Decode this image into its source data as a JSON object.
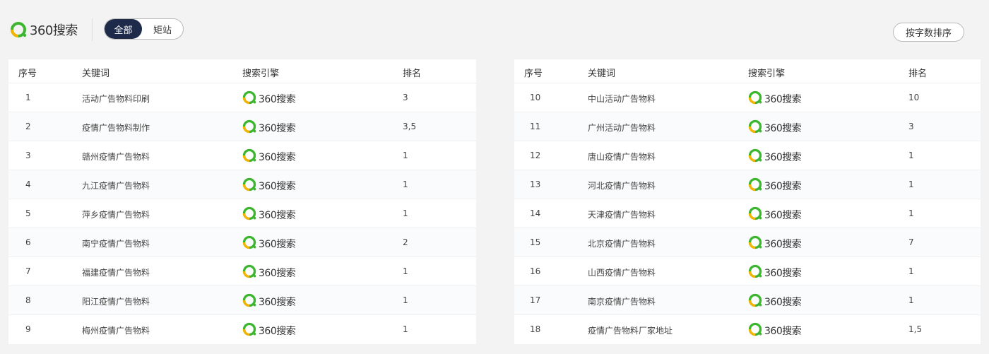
{
  "header": {
    "logo_text": "360搜索",
    "filters": [
      {
        "label": "全部",
        "active": true
      },
      {
        "label": "矩站",
        "active": false
      }
    ],
    "sort_label": "按字数排序"
  },
  "table": {
    "columns": [
      "序号",
      "关键词",
      "搜索引擎",
      "排名"
    ],
    "engine_label": "360搜索",
    "left_rows": [
      {
        "no": "1",
        "keyword": "活动广告物料印刷",
        "rank": "3"
      },
      {
        "no": "2",
        "keyword": "疫情广告物料制作",
        "rank": "3,5"
      },
      {
        "no": "3",
        "keyword": "赣州疫情广告物料",
        "rank": "1"
      },
      {
        "no": "4",
        "keyword": "九江疫情广告物料",
        "rank": "1"
      },
      {
        "no": "5",
        "keyword": "萍乡疫情广告物料",
        "rank": "1"
      },
      {
        "no": "6",
        "keyword": "南宁疫情广告物料",
        "rank": "2"
      },
      {
        "no": "7",
        "keyword": "福建疫情广告物料",
        "rank": "1"
      },
      {
        "no": "8",
        "keyword": "阳江疫情广告物料",
        "rank": "1"
      },
      {
        "no": "9",
        "keyword": "梅州疫情广告物料",
        "rank": "1"
      }
    ],
    "right_rows": [
      {
        "no": "10",
        "keyword": "中山活动广告物料",
        "rank": "10"
      },
      {
        "no": "11",
        "keyword": "广州活动广告物料",
        "rank": "3"
      },
      {
        "no": "12",
        "keyword": "唐山疫情广告物料",
        "rank": "1"
      },
      {
        "no": "13",
        "keyword": "河北疫情广告物料",
        "rank": "1"
      },
      {
        "no": "14",
        "keyword": "天津疫情广告物料",
        "rank": "1"
      },
      {
        "no": "15",
        "keyword": "北京疫情广告物料",
        "rank": "7"
      },
      {
        "no": "16",
        "keyword": "山西疫情广告物料",
        "rank": "1"
      },
      {
        "no": "17",
        "keyword": "南京疫情广告物料",
        "rank": "1"
      },
      {
        "no": "18",
        "keyword": "疫情广告物料厂家地址",
        "rank": "1,5"
      }
    ]
  },
  "colors": {
    "active_filter_bg": "#1d2a4a",
    "logo_green": "#3cb62e",
    "logo_yellow": "#f5b400"
  }
}
